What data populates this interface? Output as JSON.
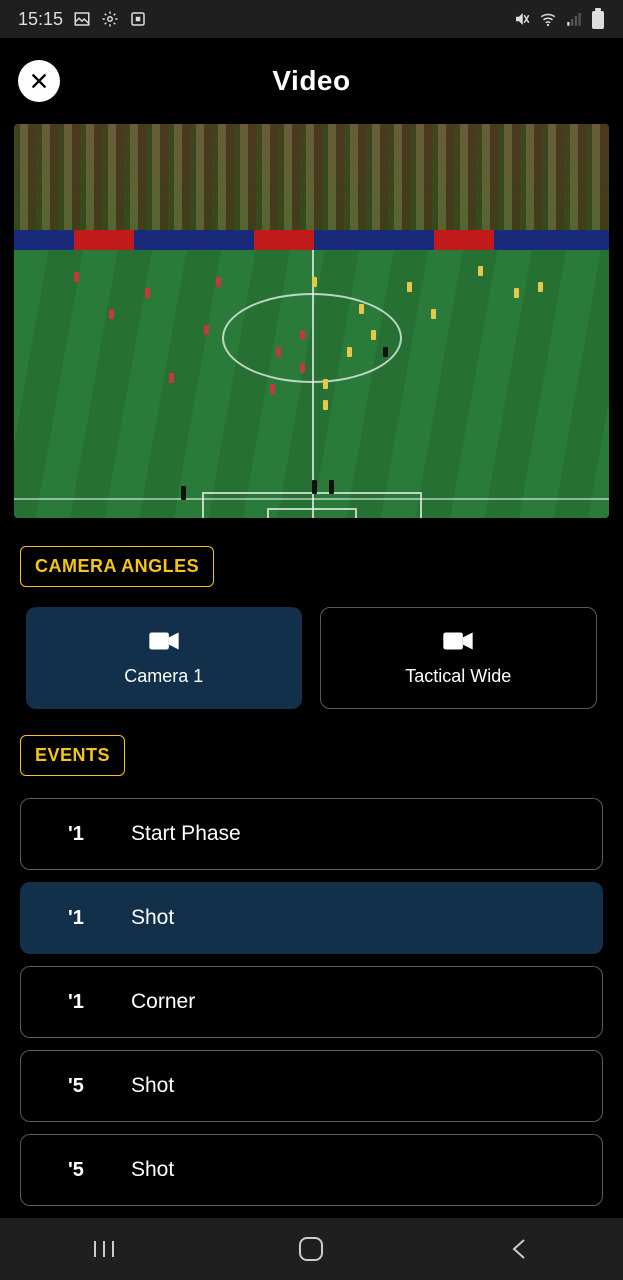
{
  "status_bar": {
    "time": "15:15"
  },
  "header": {
    "title": "Video"
  },
  "sections": {
    "camera_label": "CAMERA ANGLES",
    "events_label": "EVENTS"
  },
  "cameras": [
    {
      "label": "Camera 1",
      "active": true
    },
    {
      "label": "Tactical Wide",
      "active": false
    }
  ],
  "events": [
    {
      "time": "'1",
      "desc": "Start Phase",
      "active": false
    },
    {
      "time": "'1",
      "desc": "Shot",
      "active": true
    },
    {
      "time": "'1",
      "desc": "Corner",
      "active": false
    },
    {
      "time": "'5",
      "desc": "Shot",
      "active": false
    },
    {
      "time": "'5",
      "desc": "Shot",
      "active": false
    }
  ]
}
